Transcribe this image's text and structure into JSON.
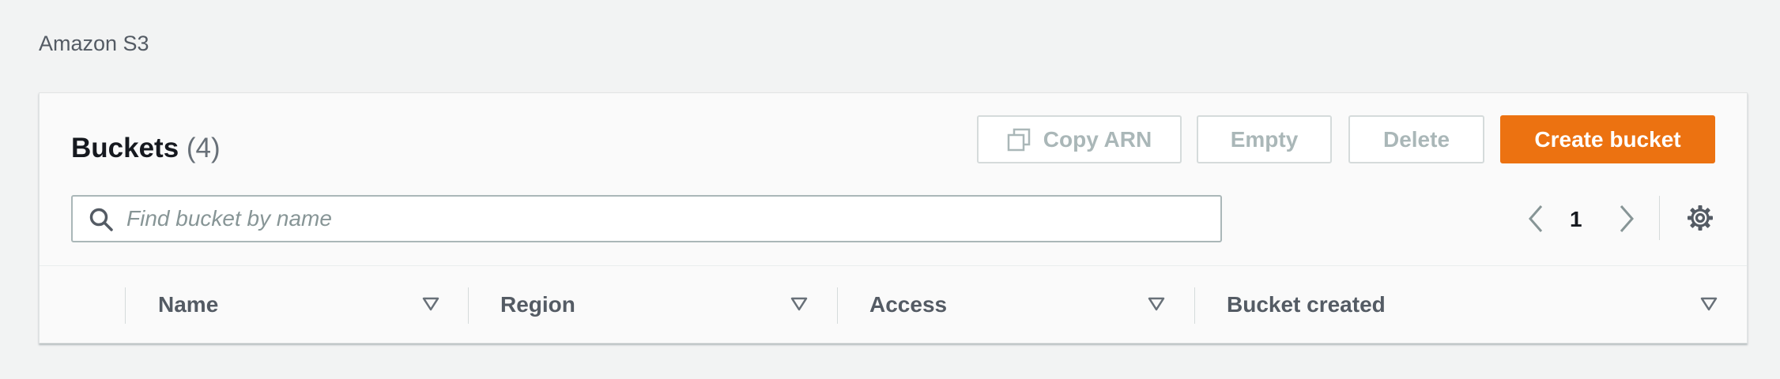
{
  "breadcrumb": "Amazon S3",
  "panel": {
    "title": "Buckets",
    "count": "(4)"
  },
  "toolbar": {
    "copy_arn_label": "Copy ARN",
    "empty_label": "Empty",
    "delete_label": "Delete",
    "create_label": "Create bucket"
  },
  "search": {
    "placeholder": "Find bucket by name",
    "value": ""
  },
  "pagination": {
    "current_page": "1"
  },
  "table": {
    "columns": [
      {
        "label": "Name"
      },
      {
        "label": "Region"
      },
      {
        "label": "Access"
      },
      {
        "label": "Bucket created"
      }
    ]
  },
  "colors": {
    "primary": "#ec7211",
    "disabled_text": "#aab7b8",
    "header_text": "#545b64"
  },
  "icons": [
    "copy-icon",
    "search-icon",
    "chevron-left-icon",
    "chevron-right-icon",
    "settings-icon",
    "sort-icon"
  ]
}
